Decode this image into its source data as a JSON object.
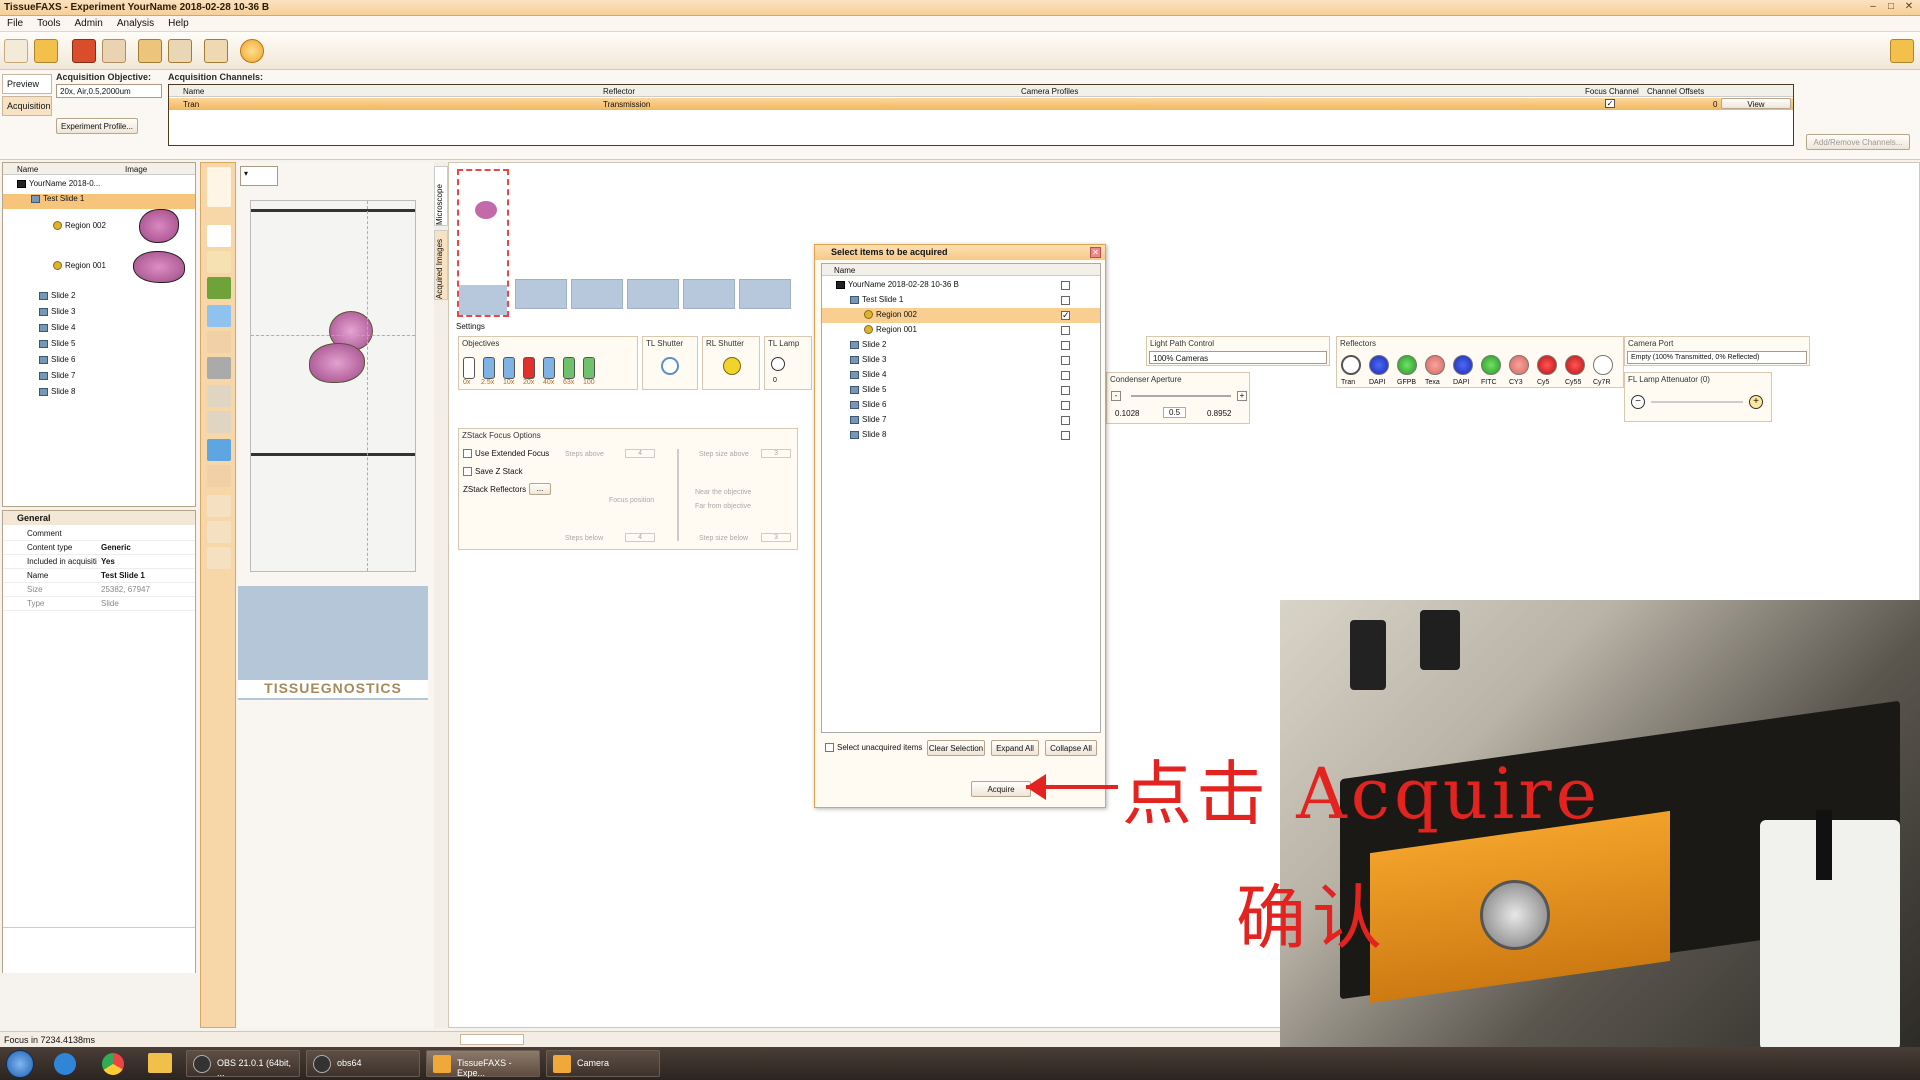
{
  "window": {
    "title": "TissueFAXS - Experiment YourName 2018-02-28 10-36 B"
  },
  "menu": [
    "File",
    "Tools",
    "Admin",
    "Analysis",
    "Help"
  ],
  "left_tabs": [
    "Preview",
    "Acquisition"
  ],
  "acquisition": {
    "objective_label": "Acquisition Objective:",
    "objective_value": "20x, Air,0.5,2000um",
    "profile_button": "Experiment Profile...",
    "channels_label": "Acquisition Channels:",
    "add_remove_button": "Add/Remove Channels..."
  },
  "channels_table": {
    "headers": [
      "Name",
      "Reflector",
      "Camera Profiles",
      "Focus Channel",
      "Channel Offsets"
    ],
    "row": {
      "name": "Tran",
      "reflector": "Transmission",
      "offset": "0",
      "view": "View"
    }
  },
  "tree": {
    "headers": [
      "Name",
      "Image"
    ],
    "items": [
      {
        "label": "YourName 2018-0...",
        "level": 0
      },
      {
        "label": "Test Slide 1",
        "level": 1
      },
      {
        "label": "Region 002",
        "level": 2
      },
      {
        "label": "Region 001",
        "level": 2
      },
      {
        "label": "Slide 2",
        "level": 1
      },
      {
        "label": "Slide 3",
        "level": 1
      },
      {
        "label": "Slide 4",
        "level": 1
      },
      {
        "label": "Slide 5",
        "level": 1
      },
      {
        "label": "Slide 6",
        "level": 1
      },
      {
        "label": "Slide 7",
        "level": 1
      },
      {
        "label": "Slide 8",
        "level": 1
      }
    ]
  },
  "general": {
    "title": "General",
    "rows": [
      {
        "k": "Comment",
        "v": ""
      },
      {
        "k": "Content type",
        "v": "Generic"
      },
      {
        "k": "Included in acquisiti",
        "v": "Yes"
      },
      {
        "k": "Name",
        "v": "Test Slide 1"
      },
      {
        "k": "Size",
        "v": "25382, 67947"
      },
      {
        "k": "Type",
        "v": "Slide"
      }
    ]
  },
  "viewer": {
    "brand": "TISSUEGNOSTICS",
    "side_tabs": [
      "Microscope",
      "Acquired Images"
    ]
  },
  "settings": {
    "label": "Settings",
    "objectives_label": "Objectives",
    "objectives": [
      "0x",
      "2.5x",
      "10x",
      "20x",
      "40x",
      "63x",
      "100"
    ],
    "tl_shutter": "TL Shutter",
    "rl_shutter": "RL Shutter",
    "tl_lamp": "TL Lamp",
    "tl_lamp_value": "0",
    "light_path_label": "Light Path Control",
    "light_path_value": "100% Cameras",
    "condenser_label": "Condenser Aperture",
    "condenser_min": "0.1028",
    "condenser_value": "0.5",
    "condenser_max": "0.8952",
    "reflectors_label": "Reflectors",
    "reflectors": [
      "Tran",
      "DAPI",
      "GFPB",
      "Texa",
      "DAPI",
      "FITC",
      "CY3",
      "Cy5",
      "Cy55",
      "Cy7R"
    ],
    "camera_port_label": "Camera Port",
    "camera_port_value": "Empty (100% Transmitted, 0% Reflected)",
    "fl_lamp_label": "FL Lamp Attenuator (0)"
  },
  "zstack": {
    "title": "ZStack Focus Options",
    "use_extended": "Use Extended Focus",
    "save_z": "Save Z Stack",
    "reflectors": "ZStack Reflectors",
    "reflectors_btn": "...",
    "steps_above": "Steps above",
    "steps_above_val": "4",
    "step_size_above": "Step size above",
    "step_size_above_val": "3",
    "focus_position": "Focus position",
    "near": "Near the objective",
    "far": "Far from objective",
    "steps_below": "Steps below",
    "steps_below_val": "4",
    "step_size_below": "Step size below",
    "step_size_below_val": "3"
  },
  "dialog": {
    "title": "Select items to be acquired",
    "header": "Name",
    "items": [
      {
        "label": "YourName 2018-02-28 10-36 B",
        "level": 0,
        "checked": false
      },
      {
        "label": "Test Slide 1",
        "level": 1,
        "checked": false
      },
      {
        "label": "Region 002",
        "level": 2,
        "checked": true
      },
      {
        "label": "Region 001",
        "level": 2,
        "checked": false
      },
      {
        "label": "Slide 2",
        "level": 1,
        "checked": false
      },
      {
        "label": "Slide 3",
        "level": 1,
        "checked": false
      },
      {
        "label": "Slide 4",
        "level": 1,
        "checked": false
      },
      {
        "label": "Slide 5",
        "level": 1,
        "checked": false
      },
      {
        "label": "Slide 6",
        "level": 1,
        "checked": false
      },
      {
        "label": "Slide 7",
        "level": 1,
        "checked": false
      },
      {
        "label": "Slide 8",
        "level": 1,
        "checked": false
      }
    ],
    "select_unacquired": "Select unacquired items",
    "clear": "Clear Selection",
    "expand": "Expand All",
    "collapse": "Collapse All",
    "acquire": "Acquire"
  },
  "overlay": {
    "line1": "点击 Acquire",
    "line2": "确认",
    "color": "#e3231f"
  },
  "status": "Focus in 7234.4138ms",
  "taskbar": [
    {
      "label": "OBS 21.0.1 (64bit, ..."
    },
    {
      "label": "obs64"
    },
    {
      "label": "TissueFAXS - Expe..."
    },
    {
      "label": "Camera"
    }
  ]
}
